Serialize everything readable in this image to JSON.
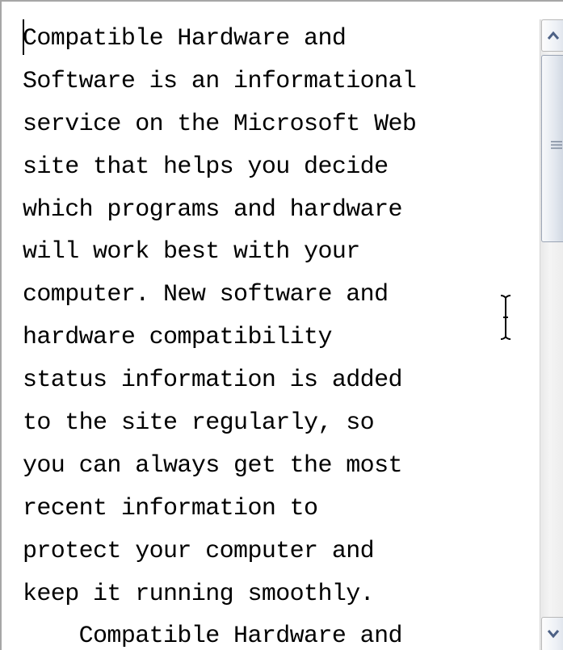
{
  "text_box": {
    "lines": [
      "Compatible Hardware and",
      "Software is an informational",
      "service on the Microsoft Web",
      "site that helps you decide",
      "which programs and hardware",
      "will work best with your",
      "computer. New software and",
      "hardware compatibility",
      "status information is added",
      "to the site regularly, so",
      "you can always get the most",
      "recent information to",
      "protect your computer and",
      "keep it running smoothly.",
      "    Compatible Hardware and"
    ]
  },
  "scrollbar": {
    "up_icon": "chevron-up-icon",
    "down_icon": "chevron-down-icon",
    "grip_icon": "grip-lines-icon",
    "thumb_fraction": 0.3
  },
  "cursor": {
    "icon": "i-beam-cursor-icon"
  },
  "colors": {
    "border": "#a6a6a6",
    "text": "#000000",
    "thumb": "#dfe4ec"
  }
}
